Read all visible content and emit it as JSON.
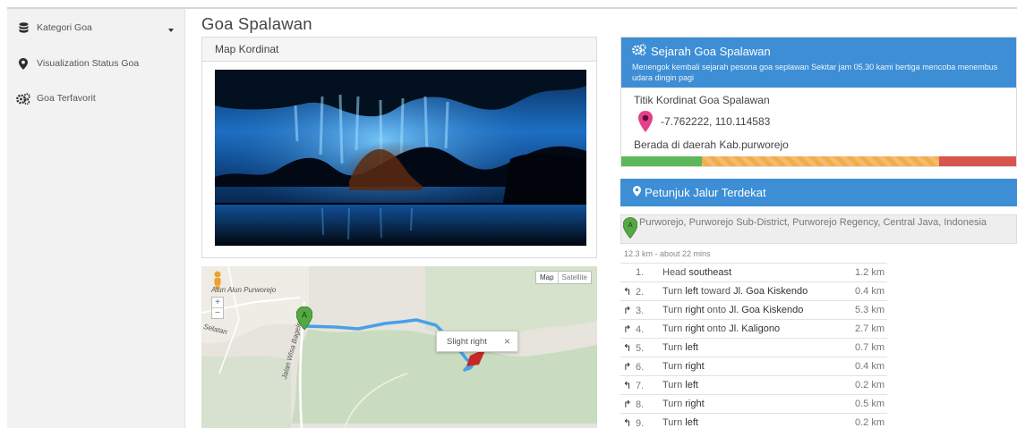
{
  "sidebar": {
    "items": [
      {
        "label": "Kategori Goa",
        "icon": "database-icon"
      },
      {
        "label": "Visualization Status Goa",
        "icon": "map-marker-icon"
      },
      {
        "label": "Goa Terfavorit",
        "icon": "cogs-icon"
      }
    ]
  },
  "page": {
    "title": "Goa Spalawan"
  },
  "photo_panel": {
    "title": "Map Kordinat"
  },
  "map": {
    "btn_map": "Map",
    "btn_satellite": "Satellite",
    "zoom_in": "+",
    "zoom_out": "−",
    "popup_text": "Slight right",
    "popup_close": "×",
    "label_alun": "Alun Alun Purworejo",
    "label_road": "Jalan Wisa Bagelen",
    "label_selatan": "Selatan",
    "marker_a": "A"
  },
  "sejarah": {
    "title": "Sejarah Goa Spalawan",
    "desc": "Menengok kembali sejarah pesona goa seplawan Sekitar jam 05.30 kami bertiga mencoba menembus udara dingin pagi",
    "titik_label": "Titik Kordinat Goa Spalawan",
    "coordinates": "-7.762222, 110.114583",
    "daerah": "Berada di daerah Kab.purworejo",
    "progress": {
      "green": 0.205,
      "orange": 0.6,
      "red": 0.195
    },
    "colors": {
      "header": "#3d8ed5",
      "green": "#5cb85c",
      "orange": "#f0ad4e",
      "red": "#d9534f"
    }
  },
  "petunjuk": {
    "title": "Petunjuk Jalur Terdekat",
    "origin_marker": "A",
    "origin": "Purworejo, Purworejo Sub-District, Purworejo Regency, Central Java, Indonesia",
    "summary": "12.3 km - about 22 mins",
    "steps": [
      {
        "arrow": "",
        "num": "1.",
        "pre": "Head ",
        "bold": "southeast",
        "post": "",
        "dist": "1.2 km"
      },
      {
        "arrow": "↰",
        "num": "2.",
        "pre": "Turn ",
        "bold": "left",
        "post": " toward ",
        "bold2": "Jl. Goa Kiskendo",
        "dist": "0.4 km"
      },
      {
        "arrow": "↱",
        "num": "3.",
        "pre": "Turn ",
        "bold": "right",
        "post": " onto ",
        "bold2": "Jl. Goa Kiskendo",
        "dist": "5.3 km"
      },
      {
        "arrow": "↱",
        "num": "4.",
        "pre": "Turn ",
        "bold": "right",
        "post": " onto ",
        "bold2": "Jl. Kaligono",
        "dist": "2.7 km"
      },
      {
        "arrow": "↰",
        "num": "5.",
        "pre": "Turn ",
        "bold": "left",
        "post": "",
        "dist": "0.7 km"
      },
      {
        "arrow": "↱",
        "num": "6.",
        "pre": "Turn ",
        "bold": "right",
        "post": "",
        "dist": "0.4 km"
      },
      {
        "arrow": "↰",
        "num": "7.",
        "pre": "Turn ",
        "bold": "left",
        "post": "",
        "dist": "0.2 km"
      },
      {
        "arrow": "↱",
        "num": "8.",
        "pre": "Turn ",
        "bold": "right",
        "post": "",
        "dist": "0.5 km"
      },
      {
        "arrow": "↰",
        "num": "9.",
        "pre": "Turn ",
        "bold": "left",
        "post": "",
        "dist": "0.2 km"
      }
    ]
  }
}
